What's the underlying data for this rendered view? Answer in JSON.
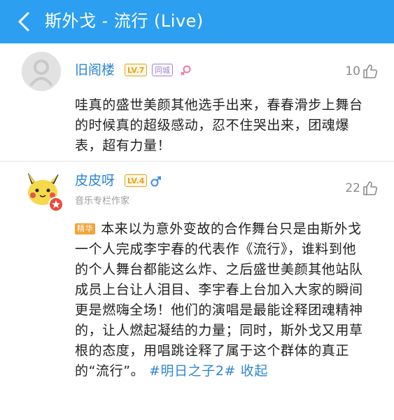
{
  "header": {
    "title": "斯外戈 - 流行 (Live)",
    "bg_color": "#2d9ff0"
  },
  "comments": [
    {
      "username": "旧阁楼",
      "level": "LV.7",
      "badge": "同城",
      "gender": "female",
      "likes": "10",
      "text": "哇真的盛世美颜其他选手出来，春春滑步上舞台的时候真的超级感动，忍不住哭出来，团魂爆表，超有力量！"
    },
    {
      "username": "皮皮呀",
      "level": "LV.4",
      "gender": "male",
      "subtitle": "音乐专栏作家",
      "likes": "22",
      "tag": "精华",
      "text": "本来以为意外变故的合作舞台只是由斯外戈一个人完成李宇春的代表作《流行》，谁料到他的个人舞台都能这么炸、之后盛世美颜其他站队成员上台让人泪目、李宇春上台加入大家的瞬间更是燃嗨全场！他们的演唱是最能诠释团魂精神的，让人燃起凝结的力量；同时，斯外戈又用草根的态度，用唱跳诠释了属于这个群体的真正的“流行”。",
      "hashtag": "#明日之子2#",
      "collapse": "收起"
    }
  ]
}
